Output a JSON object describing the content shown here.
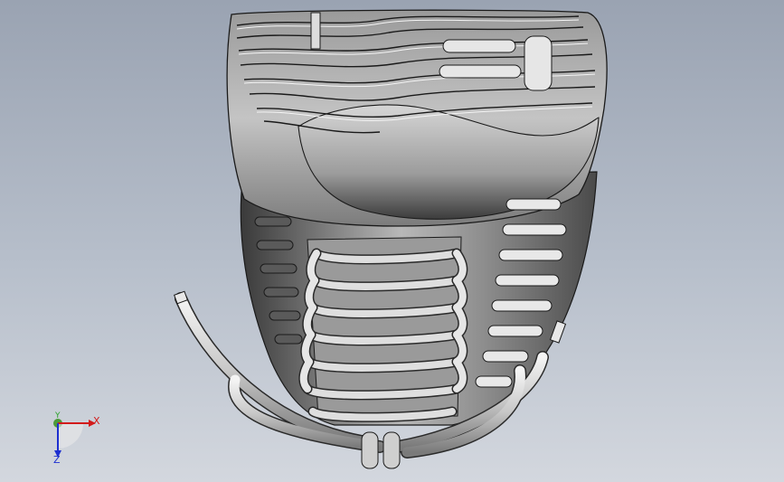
{
  "viewport": {
    "background_top": "#9aa3b2",
    "background_bottom": "#d3d7de"
  },
  "model": {
    "shading_light": "#f0f0f0",
    "shading_dark": "#2a2a2a",
    "edge_color": "#1a1a1a"
  },
  "triad": {
    "x_label": "X",
    "y_label": "Y",
    "z_label": "Z",
    "x_color": "#d21b1b",
    "y_color": "#2aa32a",
    "z_color": "#1d2fd0"
  }
}
